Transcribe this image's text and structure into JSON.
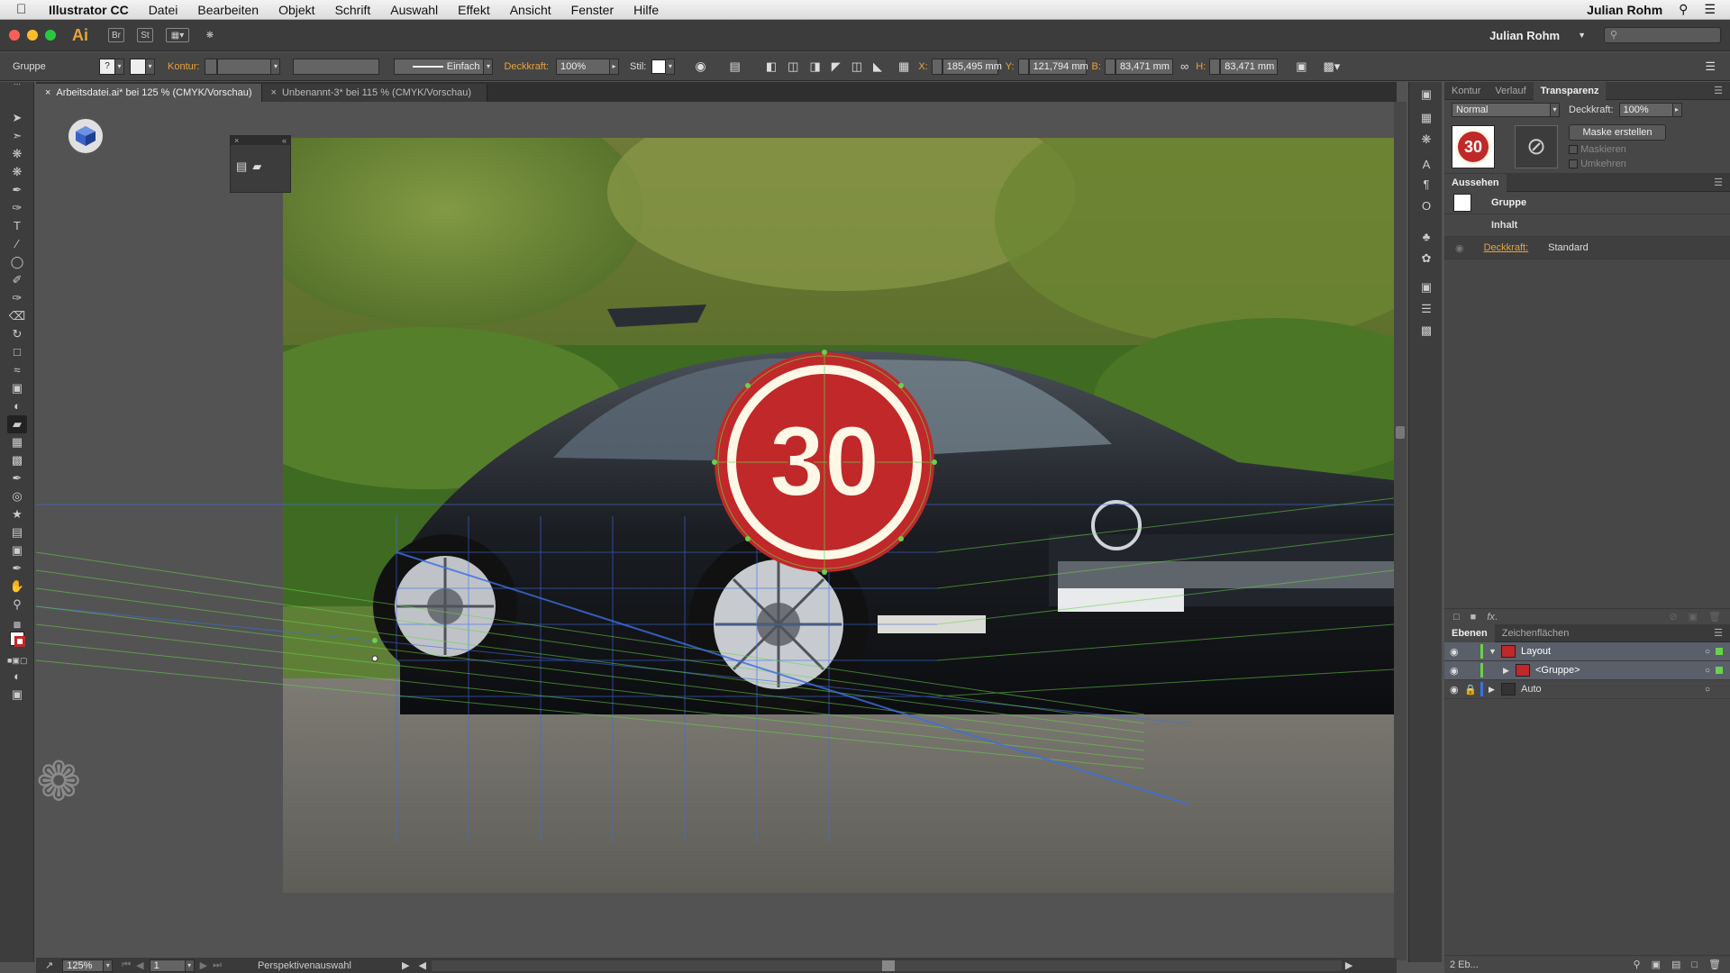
{
  "menubar": {
    "app": "Illustrator CC",
    "items": [
      "Datei",
      "Bearbeiten",
      "Objekt",
      "Schrift",
      "Auswahl",
      "Effekt",
      "Ansicht",
      "Fenster",
      "Hilfe"
    ],
    "user": "Julian Rohm"
  },
  "titlebar": {
    "logo": "Ai",
    "br": "Br",
    "st": "St",
    "user": "Julian Rohm"
  },
  "control": {
    "selection": "Gruppe",
    "kontur_label": "Kontur:",
    "stroke_style": "Einfach",
    "opacity_label": "Deckkraft:",
    "opacity_value": "100%",
    "stil_label": "Stil:",
    "x_label": "X:",
    "x_value": "185,495 mm",
    "y_label": "Y:",
    "y_value": "121,794 mm",
    "b_label": "B:",
    "b_value": "83,471 mm",
    "h_label": "H:",
    "h_value": "83,471 mm"
  },
  "tabs": [
    {
      "label": "Arbeitsdatei.ai* bei 125 % (CMYK/Vorschau)",
      "active": true
    },
    {
      "label": "Unbenannt-3* bei 115 % (CMYK/Vorschau)",
      "active": false
    }
  ],
  "artwork": {
    "badge_number": "30"
  },
  "transparency_panel": {
    "tabs": [
      "Kontur",
      "Verlauf",
      "Transparenz"
    ],
    "blend_mode": "Normal",
    "opacity_label": "Deckkraft:",
    "opacity_value": "100%",
    "make_mask": "Maske erstellen",
    "clip": "Maskieren",
    "invert": "Umkehren",
    "thumb_number": "30"
  },
  "appearance_panel": {
    "title": "Aussehen",
    "group": "Gruppe",
    "content": "Inhalt",
    "opacity_label": "Deckkraft:",
    "opacity_value": "Standard"
  },
  "layers_panel": {
    "tabs": [
      "Ebenen",
      "Zeichenflächen"
    ],
    "layers": [
      {
        "name": "Layout",
        "expanded": true
      },
      {
        "name": "<Gruppe>",
        "expanded": false
      },
      {
        "name": "Auto",
        "expanded": false
      }
    ],
    "footer": "2 Eb..."
  },
  "status": {
    "zoom": "125%",
    "page": "1",
    "tool": "Perspektivenauswahl"
  },
  "colors": {
    "accent": "#e8a23d",
    "badge_red": "#c0282a",
    "badge_cream": "#fff8e6",
    "grid_blue": "#3d6fe0",
    "grid_green": "#6ad14a"
  }
}
